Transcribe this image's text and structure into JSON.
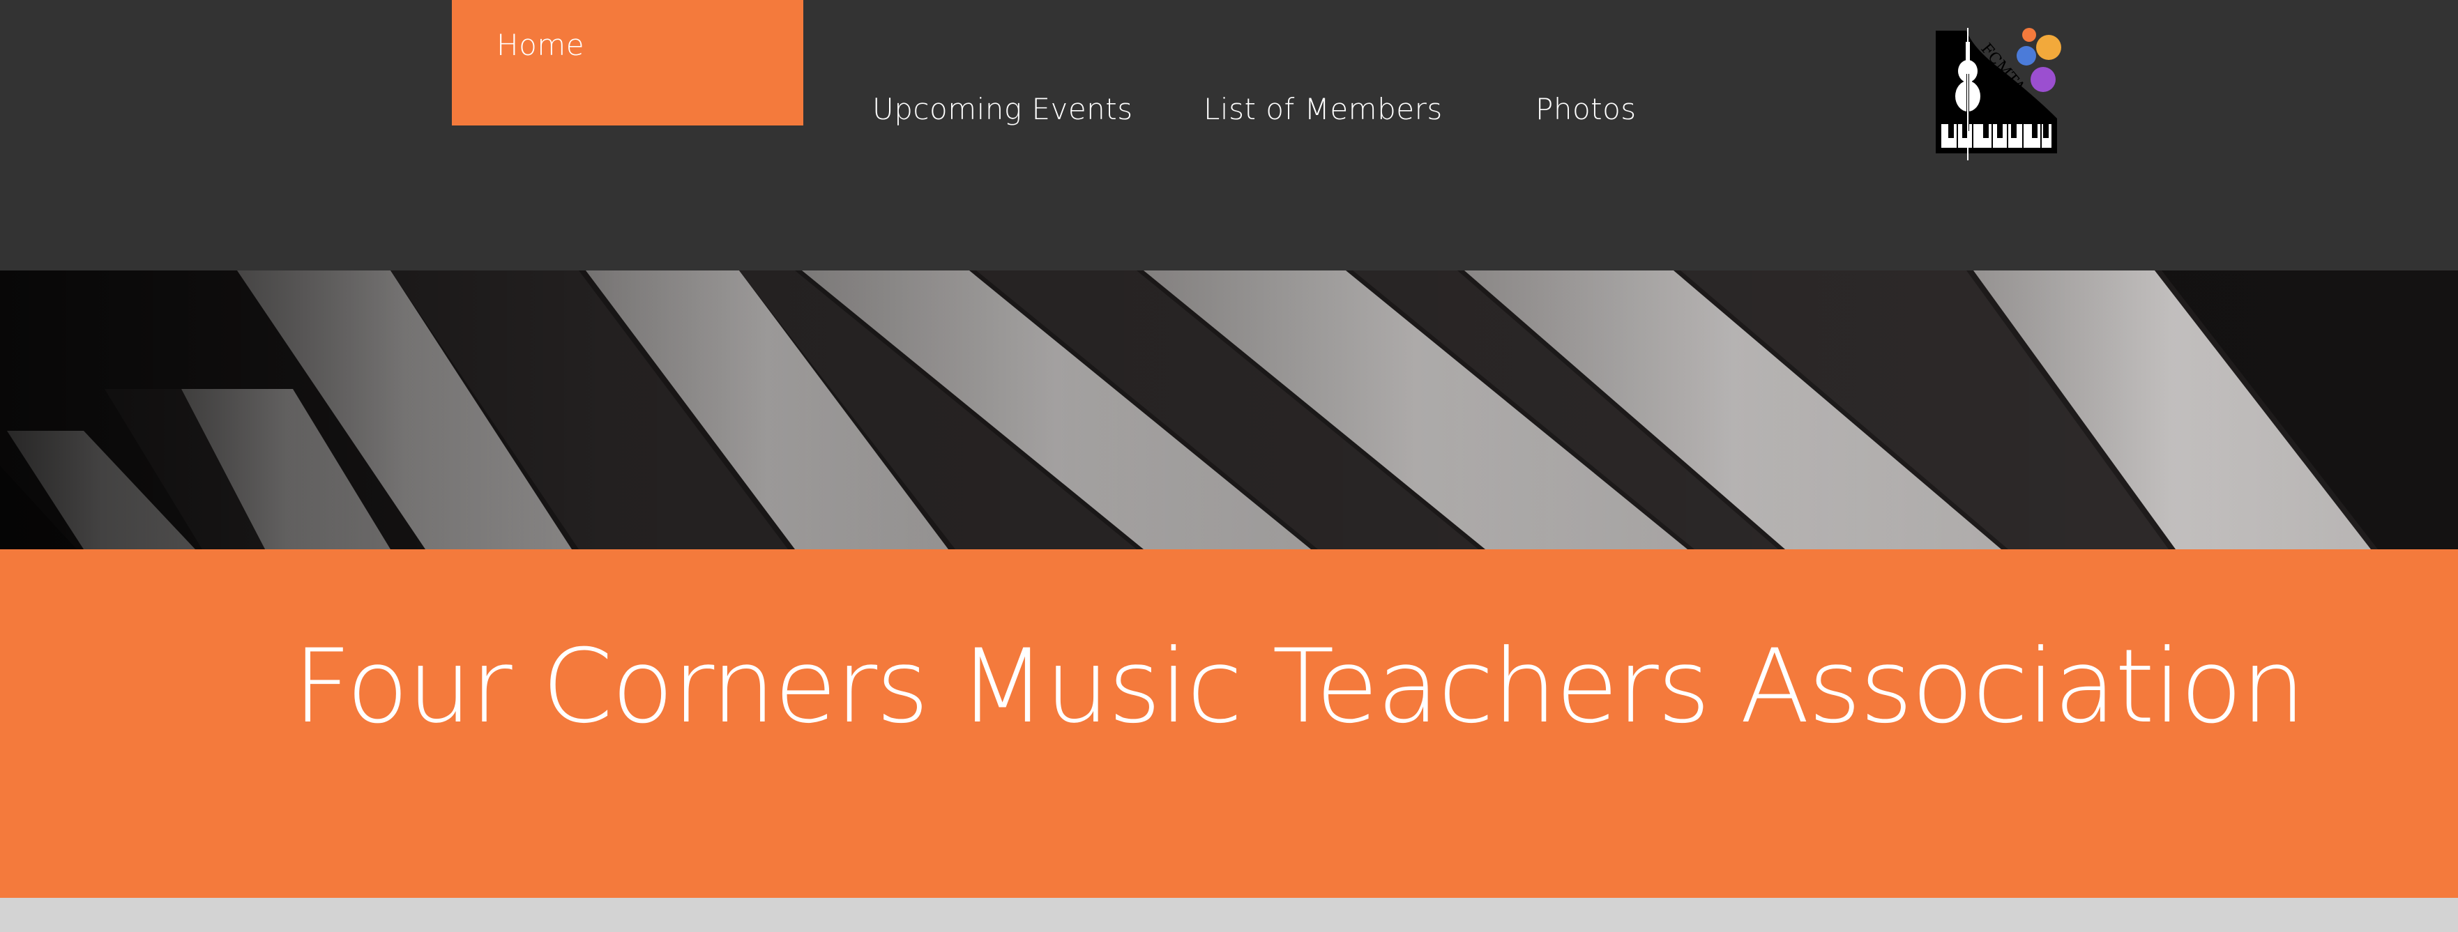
{
  "nav": {
    "items": [
      {
        "label": "Home",
        "active": true
      },
      {
        "label": "Upcoming Events",
        "active": false
      },
      {
        "label": "List of Members",
        "active": false
      },
      {
        "label": "Photos",
        "active": false
      }
    ]
  },
  "logo": {
    "text": "FCMTA",
    "icon": "violin-piano-logo-icon"
  },
  "banner": {
    "image": "piano-keys-photo"
  },
  "hero": {
    "title": "Four Corners Music Teachers Association"
  },
  "colors": {
    "accent": "#f47a3c",
    "header_bg": "#333333",
    "footer_bg": "#d3d3d3",
    "text": "#ffffff"
  }
}
